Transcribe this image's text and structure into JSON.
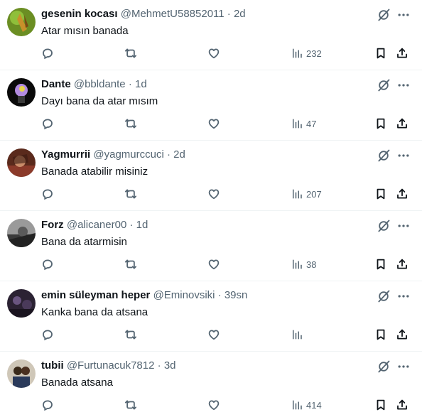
{
  "colors": {
    "text": "#0f1419",
    "muted": "#536471",
    "divider": "#eff3f4"
  },
  "icons": [
    "reply-icon",
    "retweet-icon",
    "like-icon",
    "views-icon",
    "bookmark-icon",
    "share-icon",
    "grok-icon",
    "more-icon"
  ],
  "tweets": [
    {
      "name": "gesenin kocası",
      "handle": "@MehmetU58852011",
      "sep": "·",
      "age": "2d",
      "text": "Atar mısın banada",
      "views": "232"
    },
    {
      "name": "Dante",
      "handle": "@bbldante",
      "sep": "·",
      "age": "1d",
      "text": "Dayı bana da atar mısım",
      "views": "47"
    },
    {
      "name": "Yagmurrii",
      "handle": "@yagmurccuci",
      "sep": "·",
      "age": "2d",
      "text": "Banada atabilir misiniz",
      "views": "207"
    },
    {
      "name": "Forz",
      "handle": "@alicaner00",
      "sep": "·",
      "age": "1d",
      "text": "Bana da atarmisin",
      "views": "38"
    },
    {
      "name": "emin süleyman heper",
      "handle": "@Eminovsiki",
      "sep": "·",
      "age": "39sn",
      "text": "Kanka bana da atsana",
      "views": ""
    },
    {
      "name": "tubii",
      "handle": "@Furtunacuk7812",
      "sep": "·",
      "age": "3d",
      "text": "Banada atsana",
      "views": "414"
    }
  ]
}
